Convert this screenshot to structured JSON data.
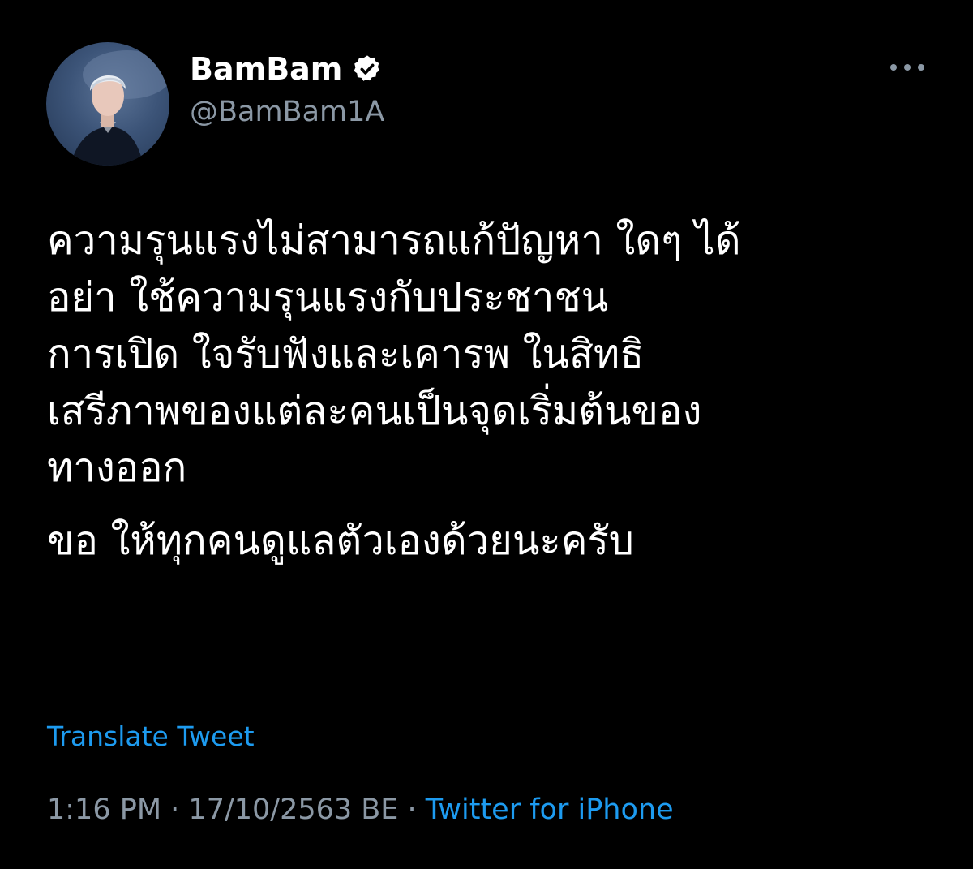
{
  "user": {
    "display_name": "BamBam",
    "handle": "@BamBam1A",
    "verified": true
  },
  "icons": {
    "avatar": "profile-photo",
    "verified": "verified-badge-icon",
    "more": "more-horizontal-icon"
  },
  "tweet": {
    "lines": [
      "ความรุนแรงไม่สามารถแก้ปัญหา ใดๆ ได้",
      "อย่า ใช้ความรุนแรงกับประชาชน",
      "การเปิด ใจรับฟังและเคารพ ในสิทธิ",
      "เสรีภาพของแต่ละคนเป็นจุดเริ่มต้นของ",
      "ทางออก"
    ],
    "closing": "ขอ ให้ทุกคนดูแลตัวเองด้วยนะครับ"
  },
  "translate_label": "Translate Tweet",
  "meta": {
    "time": "1:16 PM",
    "separator": " · ",
    "date": "17/10/2563 BE",
    "source": "Twitter for iPhone"
  },
  "colors": {
    "background": "#000000",
    "text": "#ffffff",
    "secondary": "#8b98a5",
    "link": "#1d9bf0"
  }
}
